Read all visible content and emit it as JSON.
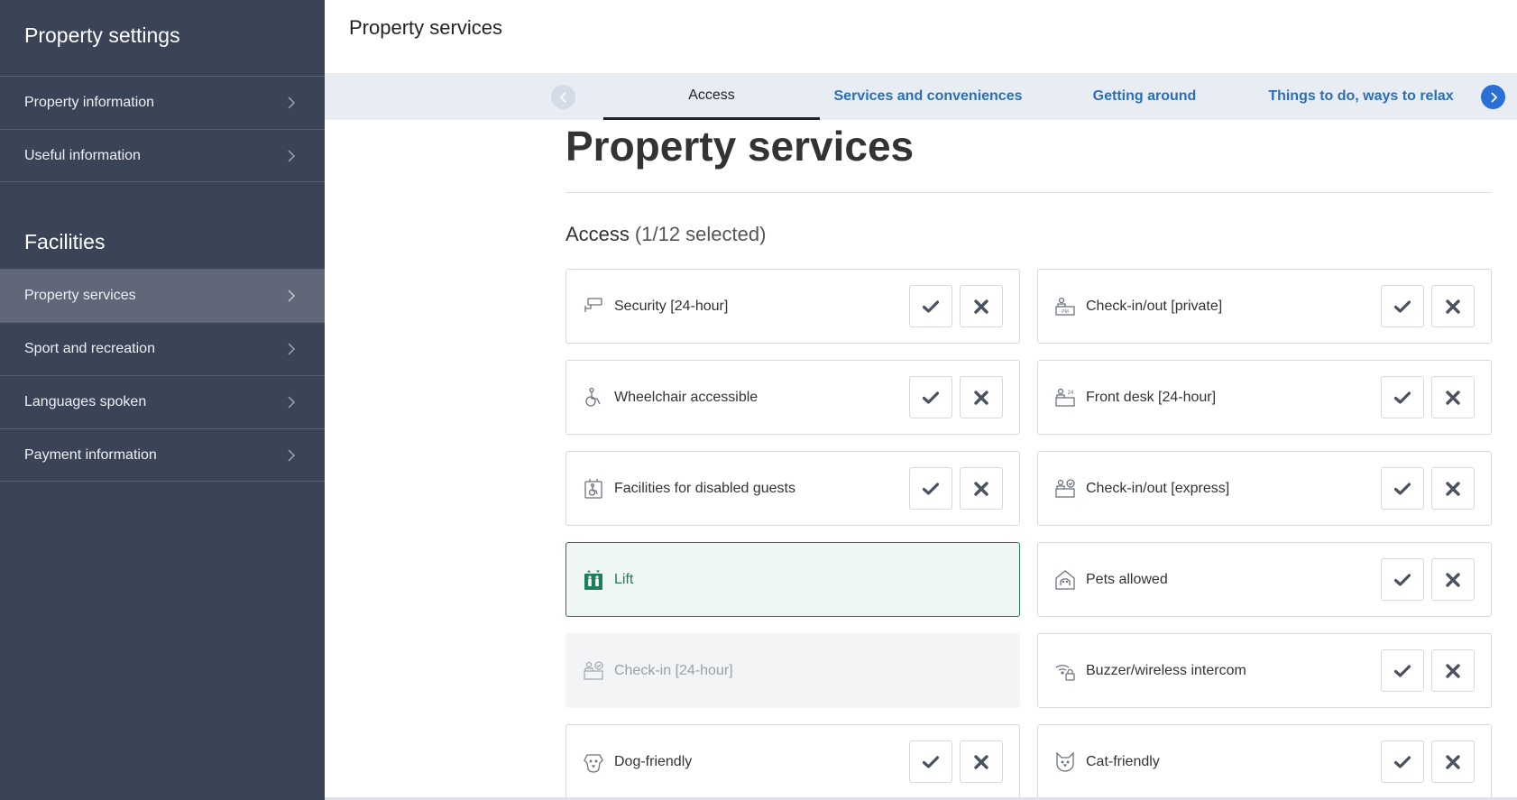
{
  "sidebar": {
    "heading1": "Property settings",
    "group1": [
      "Property information",
      "Useful information"
    ],
    "heading2": "Facilities",
    "group2": [
      "Property services",
      "Sport and recreation",
      "Languages spoken",
      "Payment information"
    ]
  },
  "header": {
    "title": "Property services"
  },
  "tabs": [
    "Access",
    "Services and conveniences",
    "Getting around",
    "Things to do, ways to relax"
  ],
  "main": {
    "title": "Property services",
    "section": {
      "name": "Access",
      "count": "(1/12 selected)"
    },
    "cards": [
      {
        "label": "Security [24-hour]",
        "icon": "security-camera-icon",
        "state": "default"
      },
      {
        "label": "Check-in/out [private]",
        "icon": "private-checkin-icon",
        "state": "default"
      },
      {
        "label": "Wheelchair accessible",
        "icon": "wheelchair-icon",
        "state": "default"
      },
      {
        "label": "Front desk [24-hour]",
        "icon": "front-desk-24-icon",
        "state": "default"
      },
      {
        "label": "Facilities for disabled guests",
        "icon": "disabled-facilities-icon",
        "state": "default"
      },
      {
        "label": "Check-in/out [express]",
        "icon": "express-checkin-icon",
        "state": "default"
      },
      {
        "label": "Lift",
        "icon": "lift-icon",
        "state": "selected"
      },
      {
        "label": "Pets allowed",
        "icon": "pets-allowed-icon",
        "state": "default"
      },
      {
        "label": "Check-in [24-hour]",
        "icon": "checkin-24-icon",
        "state": "disabled"
      },
      {
        "label": "Buzzer/wireless intercom",
        "icon": "intercom-icon",
        "state": "default"
      },
      {
        "label": "Dog-friendly",
        "icon": "dog-icon",
        "state": "default"
      },
      {
        "label": "Cat-friendly",
        "icon": "cat-icon",
        "state": "default"
      }
    ]
  },
  "colors": {
    "sidebar_bg": "#3b4456",
    "sidebar_active": "#5f6779",
    "tab_link": "#2a6fb8",
    "selected_green": "#1e7f5b",
    "arrow_blue": "#2a6fd6"
  }
}
